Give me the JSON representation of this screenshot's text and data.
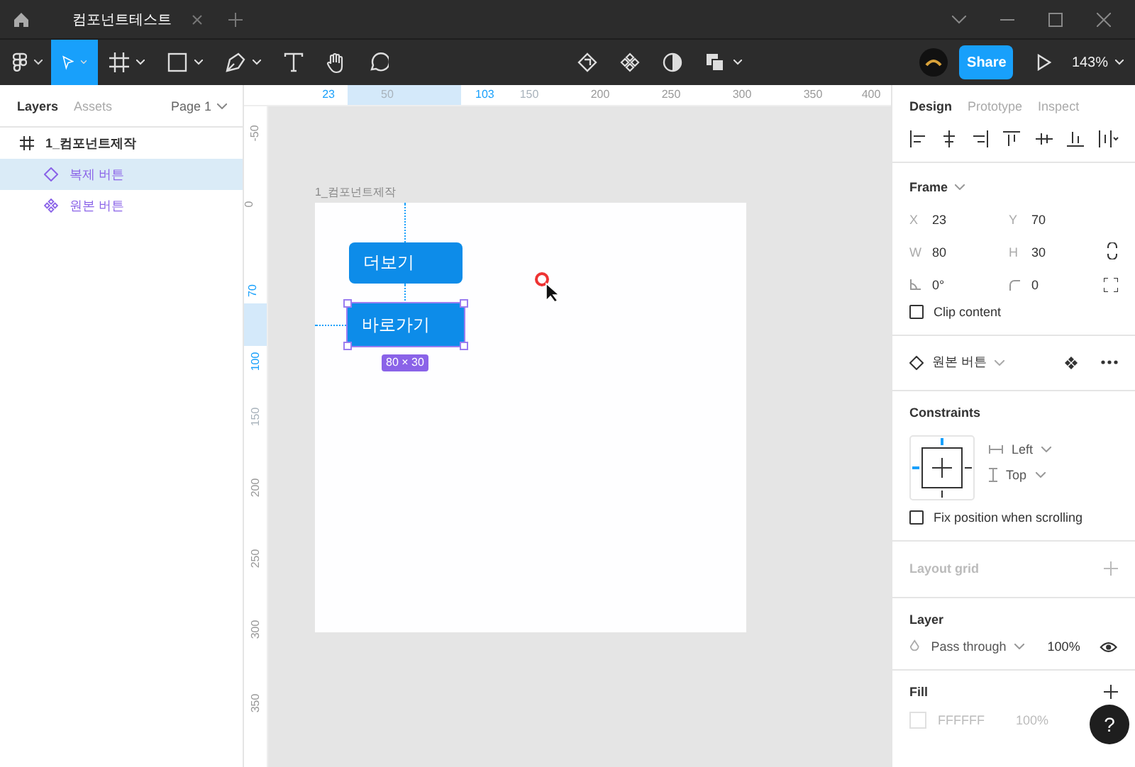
{
  "titlebar": {
    "tabs": [
      {
        "label": "컴포넌트테스트",
        "selected": true
      }
    ]
  },
  "toolbar": {
    "tools": [
      {
        "kind": "move",
        "selected": true
      },
      {
        "kind": "frame",
        "selected": false
      },
      {
        "kind": "shape",
        "selected": false
      },
      {
        "kind": "pen",
        "selected": false
      },
      {
        "kind": "text",
        "selected": false
      },
      {
        "kind": "hand",
        "selected": false
      },
      {
        "kind": "comment",
        "selected": false
      }
    ],
    "share_button": "Share",
    "zoom": "143%"
  },
  "layers_panel": {
    "tabs": [
      {
        "label": "Layers",
        "selected": true
      },
      {
        "label": "Assets",
        "selected": false
      }
    ],
    "page": "Page 1",
    "layers": [
      {
        "name": "1_컴포넌트제작",
        "kind": "frame",
        "selected": false,
        "children": [
          {
            "name": "복제 버튼",
            "kind": "instance",
            "selected": true
          },
          {
            "name": "원본 버튼",
            "kind": "component",
            "selected": false
          }
        ]
      }
    ]
  },
  "rulers": {
    "horizontal": [
      {
        "label": "23",
        "kind": "selection"
      },
      {
        "label": "50",
        "kind": "faded"
      },
      {
        "label": "103",
        "kind": "selection"
      },
      {
        "label": "150",
        "kind": "faded"
      },
      {
        "label": "200",
        "kind": "normal"
      },
      {
        "label": "250",
        "kind": "normal"
      },
      {
        "label": "300",
        "kind": "normal"
      },
      {
        "label": "350",
        "kind": "normal"
      },
      {
        "label": "400",
        "kind": "normal"
      }
    ],
    "vertical": [
      {
        "label": "-50",
        "kind": "normal"
      },
      {
        "label": "0",
        "kind": "normal"
      },
      {
        "label": "70",
        "kind": "selection"
      },
      {
        "label": "100",
        "kind": "selection"
      },
      {
        "label": "150",
        "kind": "faded"
      },
      {
        "label": "200",
        "kind": "normal"
      },
      {
        "label": "250",
        "kind": "normal"
      },
      {
        "label": "300",
        "kind": "normal"
      },
      {
        "label": "350",
        "kind": "normal"
      }
    ]
  },
  "canvas": {
    "frame_label": "1_컴포넌트제작",
    "buttons": [
      {
        "label": "더보기",
        "selected": false
      },
      {
        "label": "바로가기",
        "selected": true
      }
    ],
    "size_badge": "80 × 30"
  },
  "design_panel": {
    "tabs": [
      {
        "label": "Design",
        "selected": true
      },
      {
        "label": "Prototype",
        "selected": false
      },
      {
        "label": "Inspect",
        "selected": false
      }
    ],
    "frame": {
      "title": "Frame",
      "fields": [
        {
          "kind": "text",
          "label": "X",
          "value": "23"
        },
        {
          "kind": "text",
          "label": "Y",
          "value": "70"
        },
        {
          "kind": "text",
          "label": "W",
          "value": "80"
        },
        {
          "kind": "text",
          "label": "H",
          "value": "30"
        },
        {
          "kind": "rotation",
          "value": "0°"
        },
        {
          "kind": "radius",
          "value": "0"
        }
      ],
      "clip_content": {
        "label": "Clip content",
        "checked": false
      }
    },
    "component": {
      "name": "원본 버튼"
    },
    "constraints": {
      "title": "Constraints",
      "horizontal": "Left",
      "vertical": "Top",
      "fix_position": {
        "label": "Fix position when scrolling",
        "checked": false
      }
    },
    "layout_grid": {
      "title": "Layout grid"
    },
    "layer": {
      "title": "Layer",
      "blend": "Pass through",
      "opacity": "100%",
      "visible": true
    },
    "fill": {
      "title": "Fill",
      "color": "FFFFFF",
      "opacity": "100%"
    }
  },
  "help_button": "?"
}
